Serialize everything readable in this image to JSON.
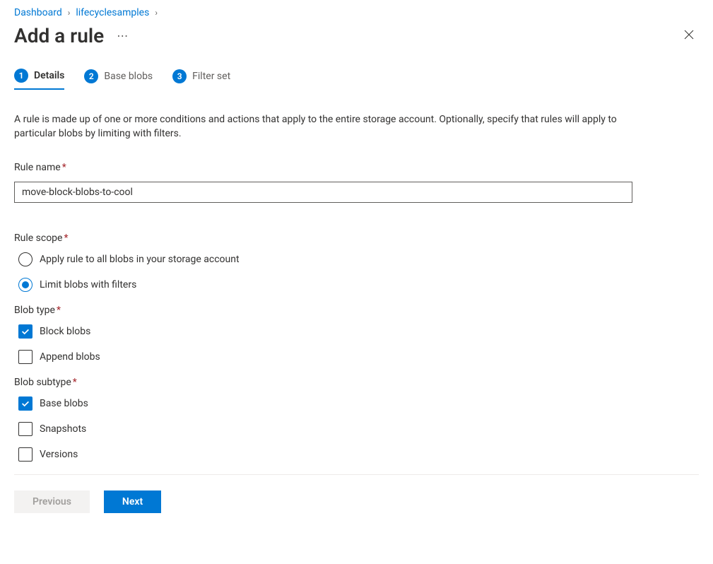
{
  "breadcrumbs": [
    {
      "label": "Dashboard"
    },
    {
      "label": "lifecyclesamples"
    }
  ],
  "header": {
    "title": "Add a rule"
  },
  "stepper": {
    "steps": [
      {
        "number": "1",
        "label": "Details",
        "active": true
      },
      {
        "number": "2",
        "label": "Base blobs",
        "active": false
      },
      {
        "number": "3",
        "label": "Filter set",
        "active": false
      }
    ]
  },
  "description": "A rule is made up of one or more conditions and actions that apply to the entire storage account. Optionally, specify that rules will apply to particular blobs by limiting with filters.",
  "form": {
    "rule_name": {
      "label": "Rule name",
      "value": "move-block-blobs-to-cool"
    },
    "rule_scope": {
      "label": "Rule scope",
      "options": [
        {
          "label": "Apply rule to all blobs in your storage account",
          "checked": false
        },
        {
          "label": "Limit blobs with filters",
          "checked": true
        }
      ]
    },
    "blob_type": {
      "label": "Blob type",
      "options": [
        {
          "label": "Block blobs",
          "checked": true
        },
        {
          "label": "Append blobs",
          "checked": false
        }
      ]
    },
    "blob_subtype": {
      "label": "Blob subtype",
      "options": [
        {
          "label": "Base blobs",
          "checked": true
        },
        {
          "label": "Snapshots",
          "checked": false
        },
        {
          "label": "Versions",
          "checked": false
        }
      ]
    }
  },
  "buttons": {
    "previous": "Previous",
    "next": "Next"
  }
}
